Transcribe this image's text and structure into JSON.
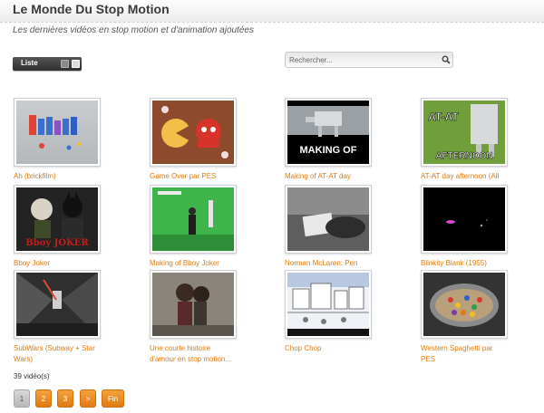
{
  "header": {
    "title": "Le Monde Du Stop Motion",
    "subtitle": "Les dernières vidéos en stop motion et d'animation ajoutées"
  },
  "toolbar": {
    "view_label": "Liste",
    "search_placeholder": "Rechercher..."
  },
  "videos": [
    {
      "caption": "Ah (brickfilm)"
    },
    {
      "caption": "Game Over par PES"
    },
    {
      "caption": "Making of AT-AT day"
    },
    {
      "caption": "AT-AT day afternoon (All"
    },
    {
      "caption": "Bboy Joker",
      "thumb_text": "Bboy Joker"
    },
    {
      "caption": "Making of Bboy Joker"
    },
    {
      "caption": "Norman McLaren: Pen"
    },
    {
      "caption": "Blinkity Blank (1955)"
    },
    {
      "caption": "SubWars (Subway + Star Wars)"
    },
    {
      "caption": "Une courte histoire d'amour en stop motion..."
    },
    {
      "caption": "Chop Chop"
    },
    {
      "caption": "Western Spaghetti par PES"
    }
  ],
  "thumb_texts": {
    "making_of": "MAKING OF",
    "atat_day": "AT-AT",
    "afternoon": "AFTERNOON",
    "bboy_joker": "Bboy JOKER"
  },
  "pagination": {
    "count_label": "39 vidéo(s)",
    "pages": [
      "1",
      "2",
      "3",
      ">",
      "Fin"
    ],
    "current": "1"
  },
  "colors": {
    "accent": "#e07b12",
    "title": "#3a3a3a"
  }
}
